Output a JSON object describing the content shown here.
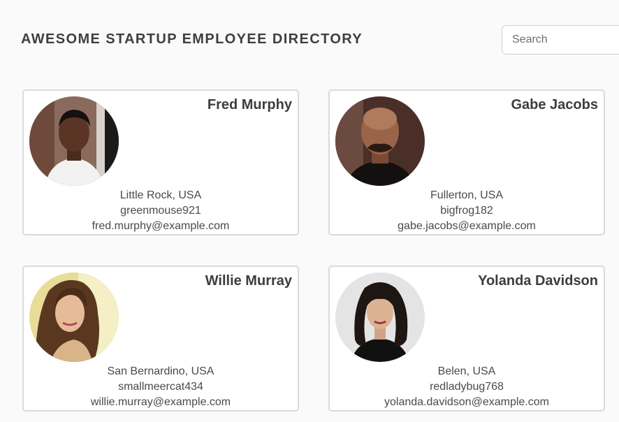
{
  "header": {
    "title": "AWESOME STARTUP EMPLOYEE DIRECTORY"
  },
  "search": {
    "placeholder": "Search",
    "value": ""
  },
  "employees": [
    {
      "name": "Fred Murphy",
      "location": "Little Rock, USA",
      "username": "greenmouse921",
      "email": "fred.murphy@example.com"
    },
    {
      "name": "Gabe Jacobs",
      "location": "Fullerton, USA",
      "username": "bigfrog182",
      "email": "gabe.jacobs@example.com"
    },
    {
      "name": "Willie Murray",
      "location": "San Bernardino, USA",
      "username": "smallmeercat434",
      "email": "willie.murray@example.com"
    },
    {
      "name": "Yolanda Davidson",
      "location": "Belen, USA",
      "username": "redladybug768",
      "email": "yolanda.davidson@example.com"
    }
  ]
}
